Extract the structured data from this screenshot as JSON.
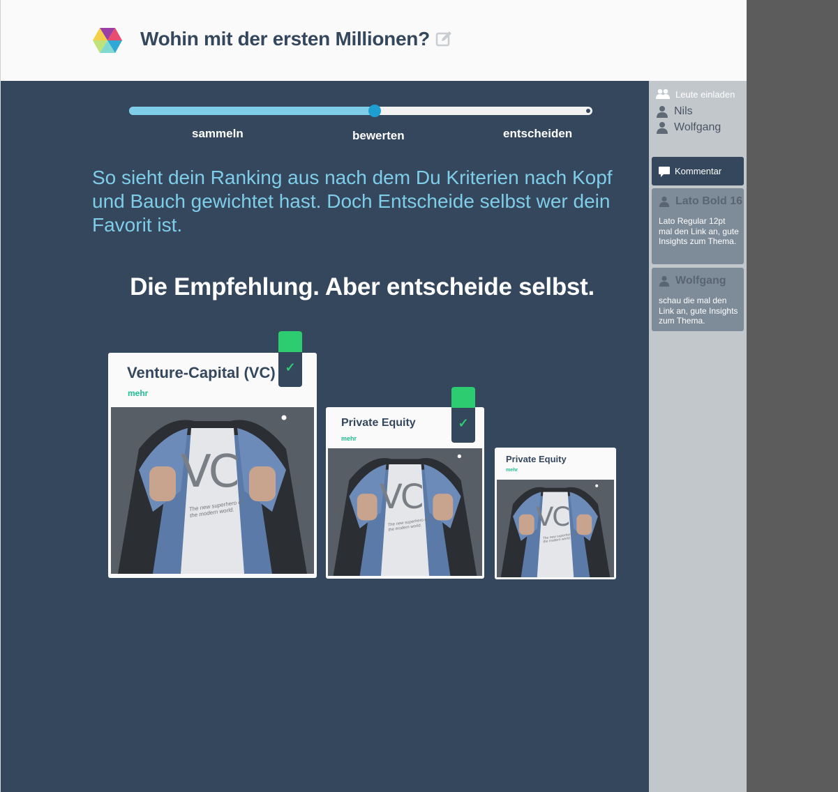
{
  "header": {
    "title": "Wohin mit der ersten Millionen?",
    "logo_icon": "hexagon-logo-icon",
    "edit_icon": "edit-icon"
  },
  "progress": {
    "value": 0.53,
    "steps": [
      "sammeln",
      "bewerten",
      "entscheiden"
    ]
  },
  "intro_text": "So sieht dein Ranking aus nach dem Du Kriterien nach Kopf und Bauch gewichtet hast. Doch Entscheide selbst wer dein Favorit ist.",
  "headline": "Die Empfehlung. Aber entscheide selbst.",
  "cards": [
    {
      "title": "Venture-Capital (VC)",
      "more": "mehr",
      "image_text": "VC",
      "image_sub": "The new superhero of the modern world.",
      "checked": true
    },
    {
      "title": "Private Equity",
      "more": "mehr",
      "image_text": "VC",
      "image_sub": "The new superhero of the modern world.",
      "checked": true
    },
    {
      "title": "Private Equity",
      "more": "mehr",
      "image_text": "VC",
      "image_sub": "The new superhero of the modern world.",
      "checked": false
    }
  ],
  "sidebar": {
    "invite_label": "Leute einladen",
    "people": [
      "Nils",
      "Wolfgang"
    ],
    "comment_button": "Kommentar",
    "comments": [
      {
        "author": "Lato Bold 16",
        "text": "Lato Regular 12pt mal den Link an, gute Insights zum Thema."
      },
      {
        "author": "Wolfgang",
        "text": "schau die mal den Link an, gute Insights zum Thema."
      }
    ]
  },
  "colors": {
    "primary": "#34475d",
    "accent": "#7fcde8",
    "progress_knob": "#1d9fd1",
    "check": "#2ecc71",
    "more_link": "#1fbf8f"
  }
}
